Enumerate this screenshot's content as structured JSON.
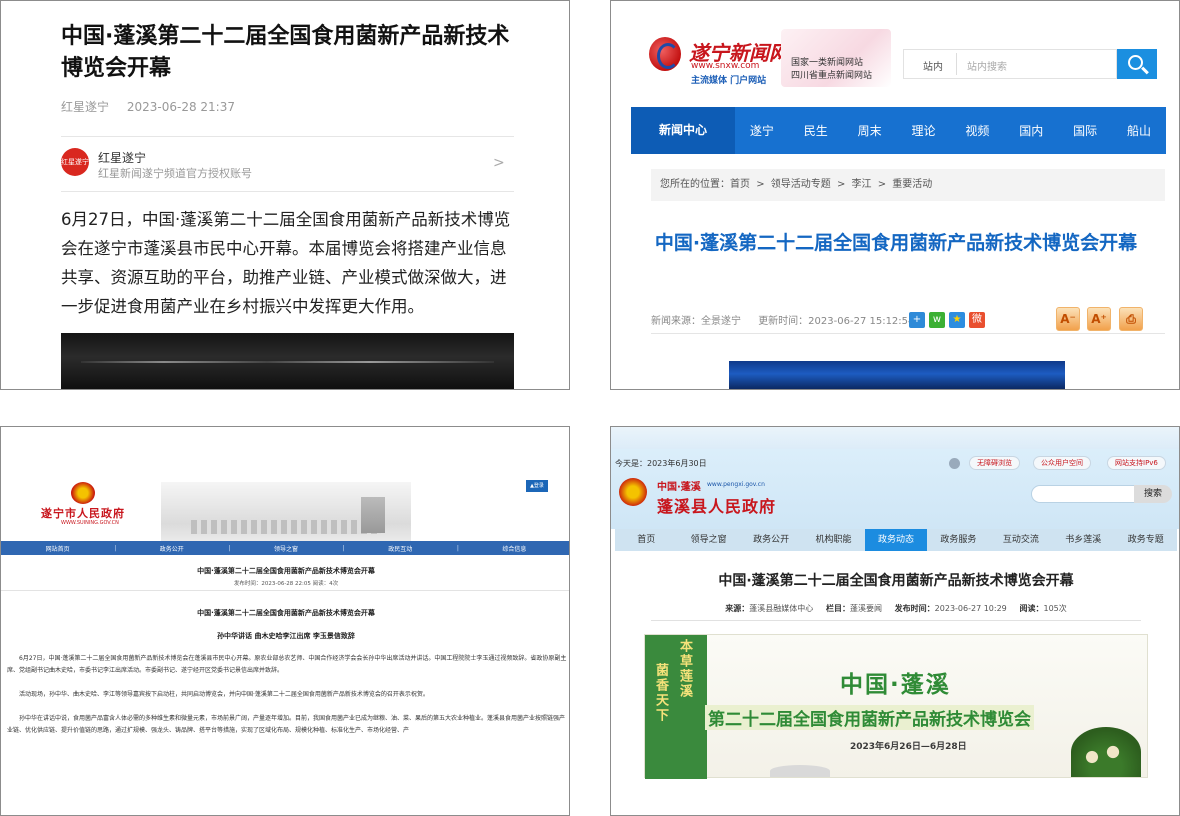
{
  "p1": {
    "title": "中国·蓬溪第二十二届全国食用菌新产品新技术博览会开幕",
    "source": "红星遂宁",
    "time": "2023-06-28 21:37",
    "author_avatar_text": "红星遂宁",
    "author_name": "红星遂宁",
    "author_desc": "红星新闻遂宁频道官方授权账号",
    "chevron": ">",
    "body": "6月27日，中国·蓬溪第二十二届全国食用菌新产品新技术博览会在遂宁市蓬溪县市民中心开幕。本届博览会将搭建产业信息共享、资源互助的平台，助推产业链、产业模式做深做大，进一步促进食用菌产业在乡村振兴中发挥更大作用。"
  },
  "p2": {
    "logo_name": "遂宁新闻网",
    "logo_url": "www.snxw.com",
    "logo_tag": "主流媒体  门户网站",
    "banner_line1": "国家一类新闻网站",
    "banner_line2": "四川省重点新闻网站",
    "search_label": "站内",
    "search_placeholder": "站内搜索",
    "nav": [
      "新闻中心",
      "遂宁",
      "民生",
      "周末",
      "理论",
      "视频",
      "国内",
      "国际",
      "船山"
    ],
    "crumb": [
      "您所在的位置：首页",
      ">",
      "领导活动专题",
      ">",
      "李江",
      ">",
      "重要活动"
    ],
    "title": "中国·蓬溪第二十二届全国食用菌新产品新技术博览会开幕",
    "source": "新闻来源：全景遂宁",
    "updated": "更新时间：2023-06-27 15:12:54",
    "share_icons": [
      "+",
      "w",
      "★",
      "微"
    ],
    "tool_font_smaller": "A⁻",
    "tool_font_larger": "A⁺",
    "tool_print": "⎙"
  },
  "p3": {
    "site_name": "遂宁市人民政府",
    "site_url": "WWW.SUINING.GOV.CN",
    "login_label": "▲登录",
    "nav": [
      "网站首页",
      "政务公开",
      "领导之窗",
      "政民互动",
      "综合信息"
    ],
    "title": "中国·蓬溪第二十二届全国食用菌新产品新技术博览会开幕",
    "meta": "发布时间：2023-06-28 22:05  阅读：4次",
    "sub_title": "中国·蓬溪第二十二届全国食用菌新产品新技术博览会开幕",
    "sub_line": "孙中华讲话  曲木史哈李江出席  李玉景信致辞",
    "para1": "6月27日，中国·蓬溪第二十二届全国食用菌新产品新技术博览会在蓬溪县市民中心开幕。原农业部总农艺师、中国合作经济学会会长孙中华出席活动并讲话。中国工程院院士李玉通过视频致辞。省政协原副主席、党组副书记曲木史哈，市委书记李江出席活动。市委副书记、遂宁经开区党委书记景信出席并致辞。",
    "para2": "活动现场，孙中华、曲木史哈、李江等领导嘉宾按下启动柱，共同启动博览会，并向中国·蓬溪第二十二届全国食用菌新产品新技术博览会的召开表示祝贺。",
    "para3": "孙中华在讲话中说，食用菌产品富含人体必需的多种维生素和微量元素，市场前景广阔，产量逐年增加。目前，我国食用菌产业已成为继粮、油、菜、果后的第五大农业种植业。蓬溪县食用菌产业按照链强产业链、优化供应链、提升价值链的思路，通过扩规模、强龙头、铸品牌、搭平台等措施，实现了区域化布局、规模化种植、标准化生产、市场化经营、产"
  },
  "p4": {
    "date": "今天是：2023年6月30日",
    "top_buttons": [
      "无障碍浏览",
      "公众用户空间",
      "网站支持IPv6"
    ],
    "site_name_top": "中国·蓬溪",
    "site_url": "www.pengxi.gov.cn",
    "site_name": "蓬溪县人民政府",
    "search_button": "搜索",
    "nav": [
      "首页",
      "领导之窗",
      "政务公开",
      "机构职能",
      "政务动态",
      "政务服务",
      "互动交流",
      "书乡莲溪",
      "政务专题"
    ],
    "active_nav": "政务动态",
    "title": "中国·蓬溪第二十二届全国食用菌新产品新技术博览会开幕",
    "source_label": "来源：",
    "source": "蓬溪县融媒体中心",
    "column_label": "栏目：",
    "column": "蓬溪要闻",
    "publish_label": "发布时间：",
    "publish": "2023-06-27 10:29",
    "read_label": "阅读：",
    "read": "105次",
    "poster_vert1": "本草莲溪",
    "poster_vert2": "菌香天下",
    "poster_title": "中国·蓬溪",
    "poster_subtitle": "第二十二届全国食用菌新产品新技术博览会",
    "poster_dates": "2023年6月26日—6月28日"
  }
}
